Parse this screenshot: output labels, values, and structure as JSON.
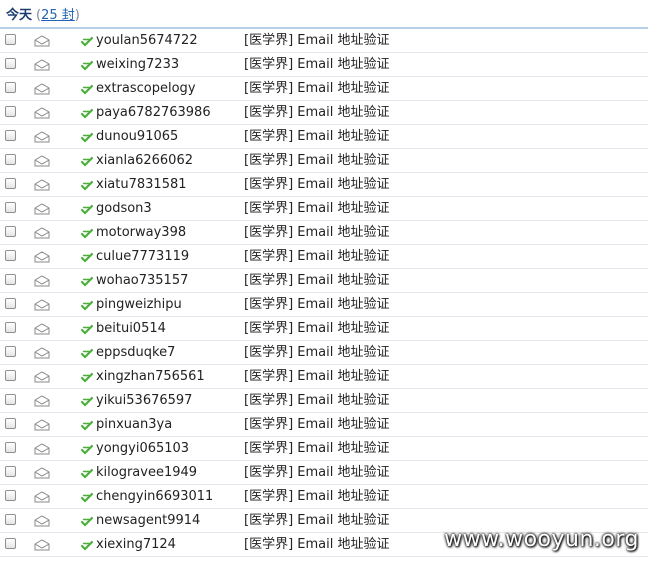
{
  "header": {
    "title": "今天",
    "count_open": "(",
    "count_text": "25 封",
    "count_close": ")"
  },
  "mails": [
    {
      "sender": "youlan5674722",
      "subject": "[医学界] Email 地址验证"
    },
    {
      "sender": "weixing7233",
      "subject": "[医学界] Email 地址验证"
    },
    {
      "sender": "extrascopelogy",
      "subject": "[医学界] Email 地址验证"
    },
    {
      "sender": "paya6782763986",
      "subject": "[医学界] Email 地址验证"
    },
    {
      "sender": "dunou91065",
      "subject": "[医学界] Email 地址验证"
    },
    {
      "sender": "xianla6266062",
      "subject": "[医学界] Email 地址验证"
    },
    {
      "sender": "xiatu7831581",
      "subject": "[医学界] Email 地址验证"
    },
    {
      "sender": "godson3",
      "subject": "[医学界] Email 地址验证"
    },
    {
      "sender": "motorway398",
      "subject": "[医学界] Email 地址验证"
    },
    {
      "sender": "culue7773119",
      "subject": "[医学界] Email 地址验证"
    },
    {
      "sender": "wohao735157",
      "subject": "[医学界] Email 地址验证"
    },
    {
      "sender": "pingweizhipu",
      "subject": "[医学界] Email 地址验证"
    },
    {
      "sender": "beitui0514",
      "subject": "[医学界] Email 地址验证"
    },
    {
      "sender": "eppsduqke7",
      "subject": "[医学界] Email 地址验证"
    },
    {
      "sender": "xingzhan756561",
      "subject": "[医学界] Email 地址验证"
    },
    {
      "sender": "yikui53676597",
      "subject": "[医学界] Email 地址验证"
    },
    {
      "sender": "pinxuan3ya",
      "subject": "[医学界] Email 地址验证"
    },
    {
      "sender": "yongyi065103",
      "subject": "[医学界] Email 地址验证"
    },
    {
      "sender": "kilogravee1949",
      "subject": "[医学界] Email 地址验证"
    },
    {
      "sender": "chengyin6693011",
      "subject": "[医学界] Email 地址验证"
    },
    {
      "sender": "newsagent9914",
      "subject": "[医学界] Email 地址验证"
    },
    {
      "sender": "xiexing7124",
      "subject": "[医学界] Email 地址验证"
    }
  ],
  "icons": {
    "row_checkbox": "checkbox-icon",
    "envelope": "envelope-icon",
    "verified_tag": "verified-tag-icon"
  },
  "colors": {
    "tag_green": "#4caf3a",
    "header_border": "#b8cfe8",
    "count_link": "#2463b4"
  },
  "watermark": {
    "text": "www.wooyun.org"
  }
}
